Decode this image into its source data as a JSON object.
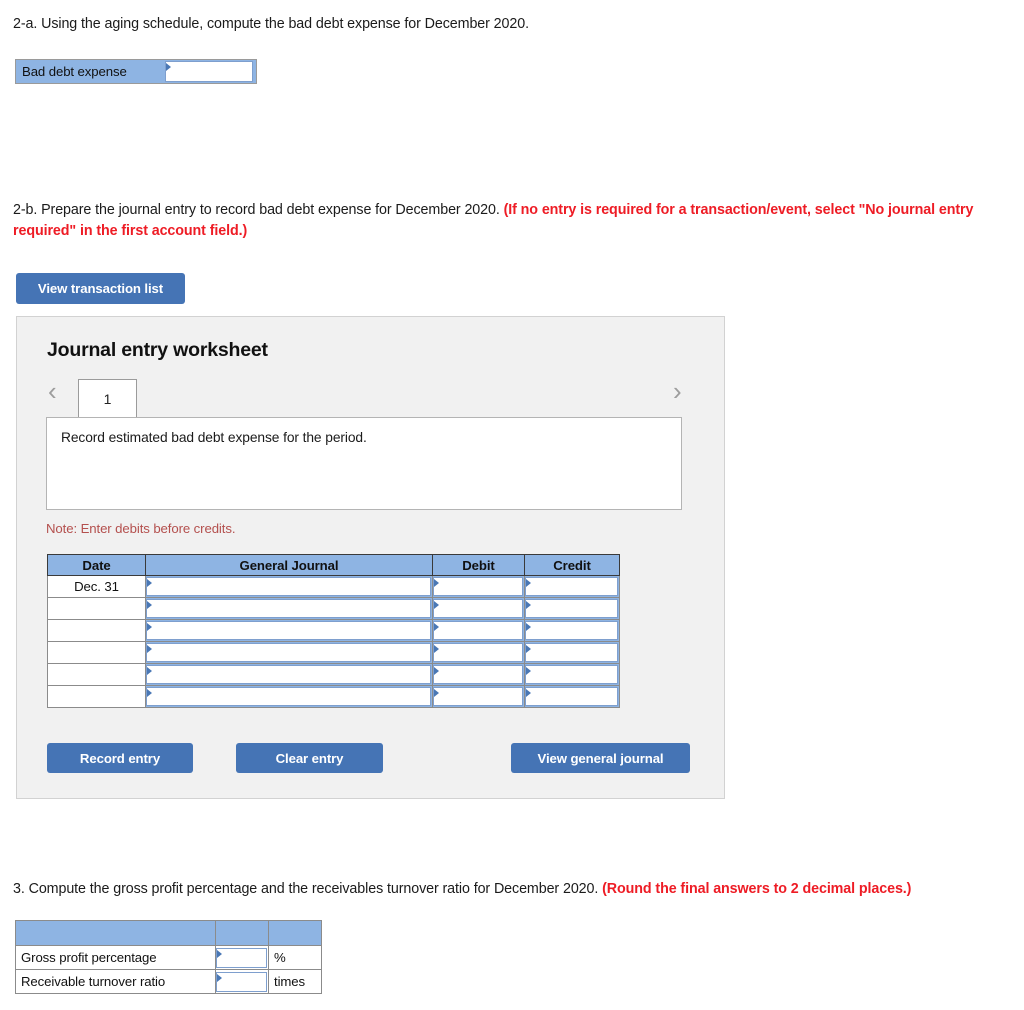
{
  "questions": {
    "q2a": {
      "text": "2-a. Using the aging schedule, compute the bad debt expense for December 2020.",
      "answer_row": {
        "label": "Bad debt expense",
        "value": ""
      }
    },
    "q2b": {
      "text": "2-b. Prepare the journal entry to record bad debt expense for December 2020. ",
      "required_note": "(If no entry is required for a transaction/event, select \"No journal entry required\" in the first account field.)"
    },
    "q3": {
      "text": "3. Compute the gross profit percentage and the receivables turnover ratio for December 2020. ",
      "required_note": "(Round the final answers to 2 decimal places.)"
    }
  },
  "buttons": {
    "view_transaction_list": "View transaction list",
    "record_entry": "Record entry",
    "clear_entry": "Clear entry",
    "view_general_journal": "View general journal"
  },
  "worksheet": {
    "title": "Journal entry worksheet",
    "prev_icon": "‹",
    "next_icon": "›",
    "tabs": [
      {
        "label": "1",
        "active": true
      }
    ],
    "description": "Record estimated bad debt expense for the period.",
    "note": "Note: Enter debits before credits.",
    "table": {
      "headers": [
        "Date",
        "General Journal",
        "Debit",
        "Credit"
      ],
      "rows": [
        {
          "date": "Dec. 31",
          "account": "",
          "debit": "",
          "credit": ""
        },
        {
          "date": "",
          "account": "",
          "debit": "",
          "credit": ""
        },
        {
          "date": "",
          "account": "",
          "debit": "",
          "credit": ""
        },
        {
          "date": "",
          "account": "",
          "debit": "",
          "credit": ""
        },
        {
          "date": "",
          "account": "",
          "debit": "",
          "credit": ""
        },
        {
          "date": "",
          "account": "",
          "debit": "",
          "credit": ""
        }
      ]
    }
  },
  "ratio_table": {
    "headers": [
      "",
      "",
      ""
    ],
    "rows": [
      {
        "label": "Gross profit percentage",
        "value": "",
        "unit": "%"
      },
      {
        "label": "Receivable turnover ratio",
        "value": "",
        "unit": "times"
      }
    ]
  },
  "colors": {
    "header_blue": "#8eb4e3",
    "button_blue": "#4574b5",
    "required_red": "#ee1c25",
    "note_red": "#b4504e",
    "panel_gray": "#f1f1f1"
  }
}
